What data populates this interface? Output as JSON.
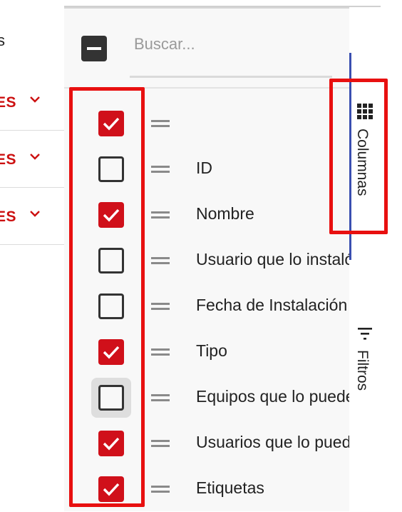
{
  "left_grid": {
    "header_fragment": "s",
    "rows": [
      {
        "value": "ES"
      },
      {
        "value": "ES"
      },
      {
        "value": "ES"
      }
    ]
  },
  "column_panel": {
    "search": {
      "placeholder": "Buscar...",
      "value": ""
    },
    "select_all_state": "indeterminate",
    "columns": [
      {
        "label": "",
        "checked": true
      },
      {
        "label": "ID",
        "checked": false
      },
      {
        "label": "Nombre",
        "checked": true
      },
      {
        "label": "Usuario que lo instaló",
        "checked": false
      },
      {
        "label": "Fecha de Instalación",
        "checked": false
      },
      {
        "label": "Tipo",
        "checked": true
      },
      {
        "label": "Equipos que lo pueden usar",
        "checked": false
      },
      {
        "label": "Usuarios que lo pueden usar",
        "checked": true
      },
      {
        "label": "Etiquetas",
        "checked": true
      }
    ]
  },
  "side_tabs": [
    {
      "label": "Columnas",
      "icon": "grid-icon",
      "active": true
    },
    {
      "label": "Filtros",
      "icon": "filter-icon",
      "active": false
    }
  ],
  "colors": {
    "accent_red": "#d0101a",
    "highlight_box": "#e81010",
    "active_tab_indicator": "#3a4fb0"
  }
}
